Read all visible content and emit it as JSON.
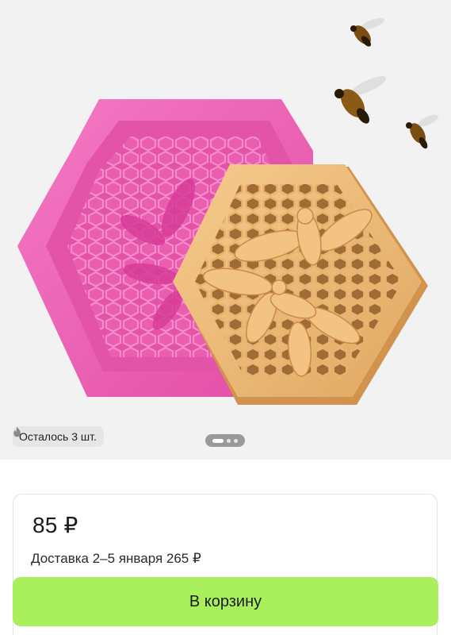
{
  "product": {
    "stock_label": "Осталось 3 шт.",
    "stock_icon": "fire-icon",
    "image_count": 3,
    "active_image": 1
  },
  "purchase": {
    "price": "85 ₽",
    "delivery": "Доставка 2–5 января 265 ₽",
    "cart_button": "В корзину"
  },
  "colors": {
    "gallery_bg": "#f2f2f2",
    "cart_button": "#a9f05c",
    "mold_pink": "#f05cb4",
    "soap_tan": "#eab574"
  }
}
